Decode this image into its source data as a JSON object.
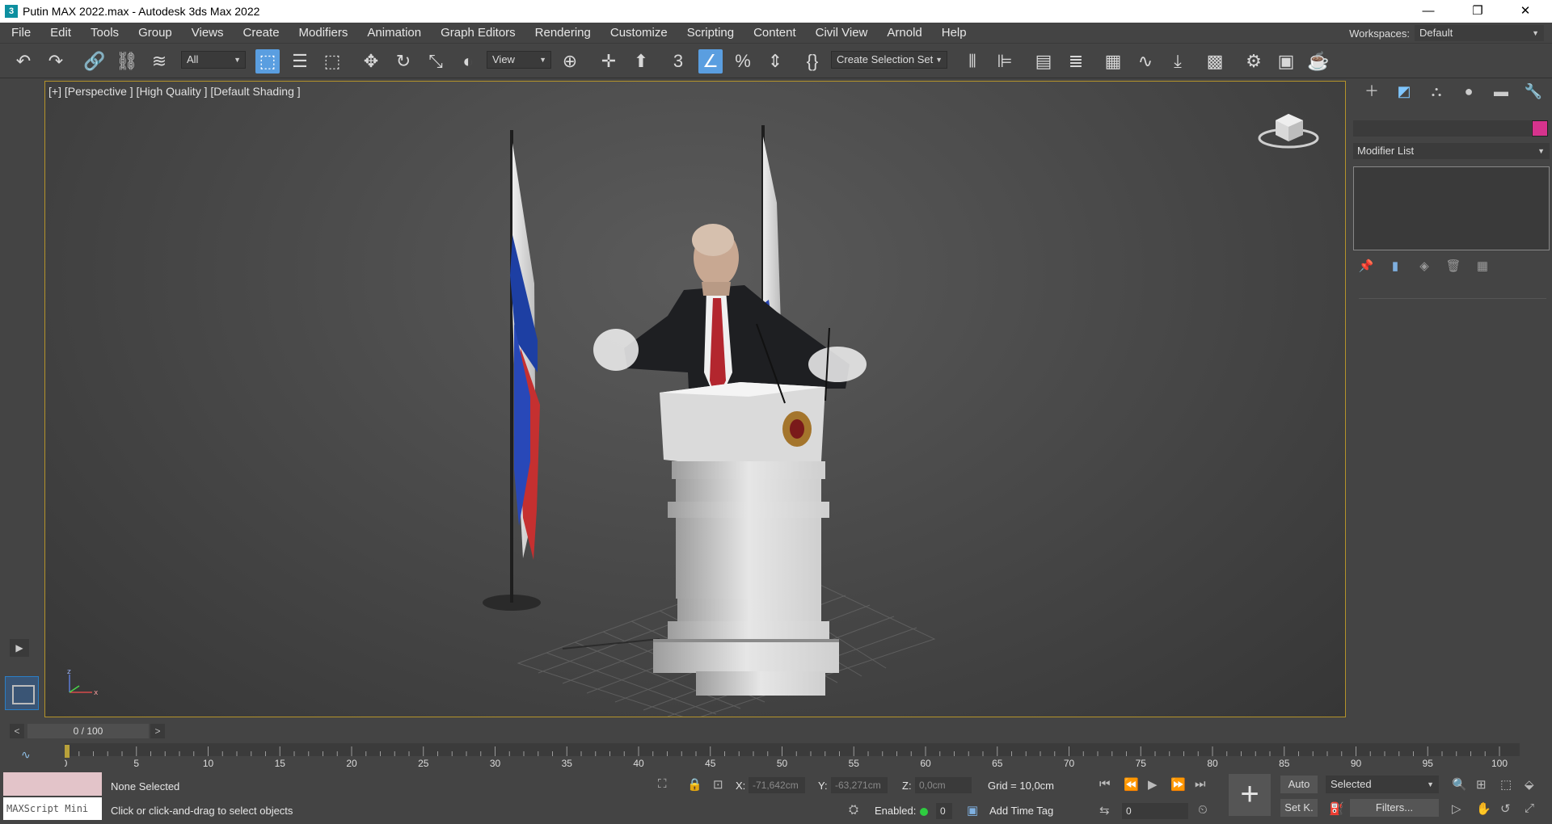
{
  "window": {
    "title": "Putin MAX 2022.max - Autodesk 3ds Max 2022",
    "app_icon": "3",
    "minimize": "—",
    "restore": "❐",
    "close": "✕"
  },
  "menu": [
    "File",
    "Edit",
    "Tools",
    "Group",
    "Views",
    "Create",
    "Modifiers",
    "Animation",
    "Graph Editors",
    "Rendering",
    "Customize",
    "Scripting",
    "Content",
    "Civil View",
    "Arnold",
    "Help"
  ],
  "workspace": {
    "label": "Workspaces:",
    "value": "Default"
  },
  "toolbar": {
    "filter_value": "All",
    "refcoord_value": "View",
    "selection_set_value": "Create Selection Set",
    "snap_label": "3",
    "percent_snap_label": "%"
  },
  "viewport": {
    "label": "[+] [Perspective ] [High Quality ] [Default Shading ]"
  },
  "command_panel": {
    "object_color": "#d6338d",
    "modifier_list": "Modifier List"
  },
  "time_slider": {
    "position": "0 / 100",
    "prev": "<",
    "next": ">"
  },
  "trackbar": {
    "ticks": [
      "0",
      "5",
      "10",
      "15",
      "20",
      "25",
      "30",
      "35",
      "40",
      "45",
      "50",
      "55",
      "60",
      "65",
      "70",
      "75",
      "80",
      "85",
      "90",
      "95",
      "100"
    ]
  },
  "status": {
    "maxscript_label": "MAXScript Mini",
    "selection_text": "None Selected",
    "prompt_text": "Click or click-and-drag to select objects",
    "x_label": "X:",
    "x_value": "-71,642cm",
    "y_label": "Y:",
    "y_value": "-63,271cm",
    "z_label": "Z:",
    "z_value": "0,0cm",
    "grid_text": "Grid = 10,0cm",
    "enabled_label": "Enabled:",
    "enabled_value": "0",
    "add_time_tag": "Add Time Tag",
    "auto_key": "Auto",
    "set_key": "Set K.",
    "key_mode": "Selected",
    "filters": "Filters...",
    "current_frame": "0"
  }
}
